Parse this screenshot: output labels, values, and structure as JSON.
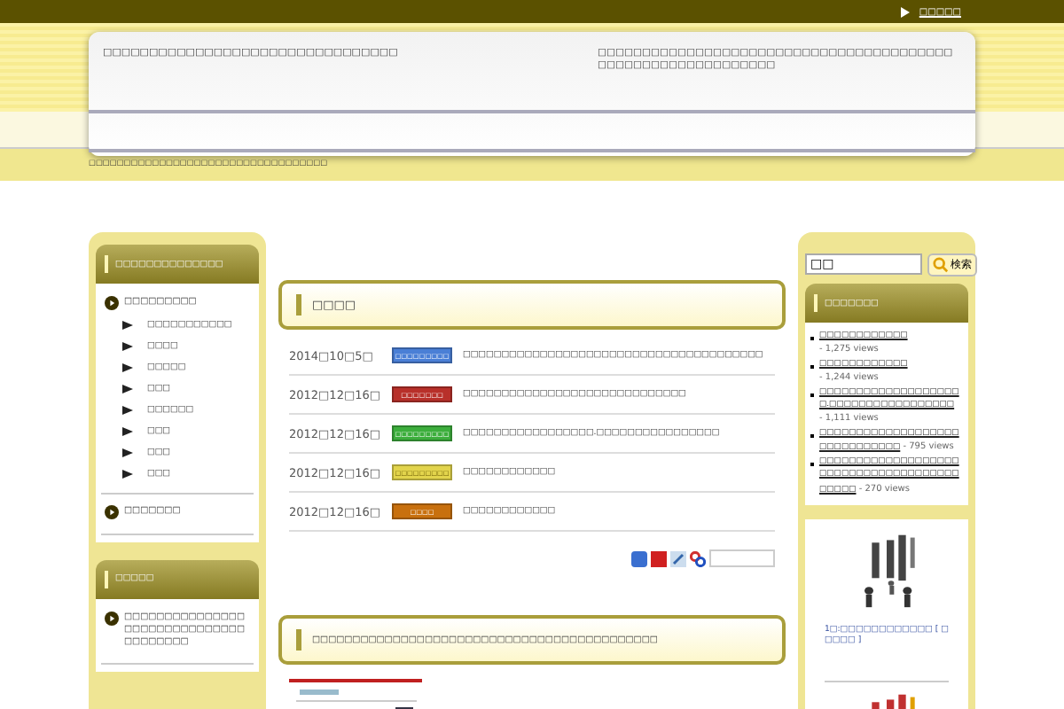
{
  "top_bar": {
    "link": "□□□□□"
  },
  "header": {
    "title": "□□□□□□□□□□□□□□□□□□□□□□□□□□□□□□□□",
    "description": "□□□□□□□□□□□□□□□□□□□□□□□□□□□□□□□□□□□□□□□□□□□□□□□□□□□□□□□□□□□□"
  },
  "breadcrumb": "□□□□□□□□□□□□□□□□□□□□□□□□□□□□□□□□□□",
  "left_sidebar": [
    {
      "title": "□□□□□□□□□□□□□□",
      "items": [
        {
          "label": "□□□□□□□□□",
          "children": [
            {
              "label": "□□□□□□□□□□□"
            },
            {
              "label": "□□□□"
            },
            {
              "label": "□□□□□"
            },
            {
              "label": "□□□"
            },
            {
              "label": "□□□□□□"
            },
            {
              "label": "□□□"
            },
            {
              "label": "□□□"
            },
            {
              "label": "□□□"
            }
          ]
        },
        {
          "label": "□□□□□□□"
        }
      ]
    },
    {
      "title": "□□□□□",
      "items": [
        {
          "label": "□□□□□□□□□□□□□□□□□□□□□□□□□□□□□□□□□□□□□□"
        }
      ]
    }
  ],
  "news": {
    "title": "□□□□",
    "rows": [
      {
        "date": "2014□10□5□",
        "tag": "□□□□□□□□□",
        "color": "#4a7fd6",
        "title": "□□□□□□□□□□□□□□□□□□□□□□□□□□□□□□□□□□□□□□□"
      },
      {
        "date": "2012□12□16□",
        "tag": "□□□□□□□",
        "color": "#b8302a",
        "title": "□□□□□□□□□□□□□□□□□□□□□□□□□□□□□"
      },
      {
        "date": "2012□12□16□",
        "tag": "□□□□□□□□□",
        "color": "#3cae3c",
        "title": "□□□□□□□□□□□□□□□□□.□□□□□□□□□□□□□□□□"
      },
      {
        "date": "2012□12□16□",
        "tag": "□□□□□□□□□",
        "color": "#e2d44c",
        "title": "□□□□□□□□□□□□"
      },
      {
        "date": "2012□12□16□",
        "tag": "□□□□",
        "color": "#c8700e",
        "title": "□□□□□□□□□□□□"
      }
    ]
  },
  "article": {
    "title": "□□□□□□□□□□□□□□□□□□□□□□□□□□□□□□□□□□□□□□□□□□□"
  },
  "right_sidebar": {
    "search": {
      "value": "□□",
      "button": "検索"
    },
    "popular": {
      "title": "□□□□□□□",
      "items": [
        {
          "title": "□□□□□□□□□□□□",
          "views": " - 1,275 views"
        },
        {
          "title": "□□□□□□□□□□□□",
          "views": " - 1,244 views"
        },
        {
          "title": "□□□□□□□□□□□□□□□□□□□□.□□□□□□□□□□□□□□□□□",
          "views": " - 1,111 views"
        },
        {
          "title": "□□□□□□□□□□□□□□□□□□□□□□□□□□□□□□",
          "views": " - 795 views"
        },
        {
          "title": "□□□□□□□□□□□□□□□□□□□□□□□□□□□□□□□□□□□□□□□□□□□",
          "views": " - 270 views"
        }
      ]
    },
    "books": [
      {
        "caption": "1□:□□□□□□□□□□□□ [ □□□□□ ]"
      }
    ]
  }
}
